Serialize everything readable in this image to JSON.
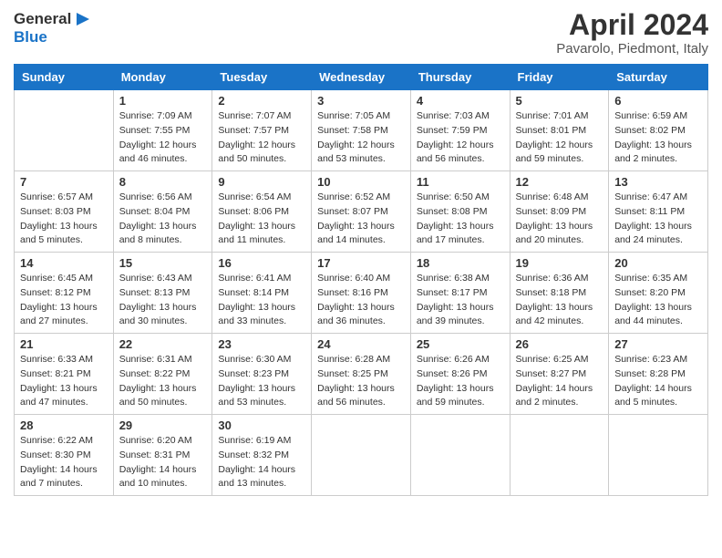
{
  "header": {
    "logo_line1": "General",
    "logo_line2": "Blue",
    "title": "April 2024",
    "subtitle": "Pavarolo, Piedmont, Italy"
  },
  "calendar": {
    "headers": [
      "Sunday",
      "Monday",
      "Tuesday",
      "Wednesday",
      "Thursday",
      "Friday",
      "Saturday"
    ],
    "weeks": [
      [
        {
          "day": null
        },
        {
          "day": 1,
          "sunrise": "Sunrise: 7:09 AM",
          "sunset": "Sunset: 7:55 PM",
          "daylight": "Daylight: 12 hours and 46 minutes."
        },
        {
          "day": 2,
          "sunrise": "Sunrise: 7:07 AM",
          "sunset": "Sunset: 7:57 PM",
          "daylight": "Daylight: 12 hours and 50 minutes."
        },
        {
          "day": 3,
          "sunrise": "Sunrise: 7:05 AM",
          "sunset": "Sunset: 7:58 PM",
          "daylight": "Daylight: 12 hours and 53 minutes."
        },
        {
          "day": 4,
          "sunrise": "Sunrise: 7:03 AM",
          "sunset": "Sunset: 7:59 PM",
          "daylight": "Daylight: 12 hours and 56 minutes."
        },
        {
          "day": 5,
          "sunrise": "Sunrise: 7:01 AM",
          "sunset": "Sunset: 8:01 PM",
          "daylight": "Daylight: 12 hours and 59 minutes."
        },
        {
          "day": 6,
          "sunrise": "Sunrise: 6:59 AM",
          "sunset": "Sunset: 8:02 PM",
          "daylight": "Daylight: 13 hours and 2 minutes."
        }
      ],
      [
        {
          "day": 7,
          "sunrise": "Sunrise: 6:57 AM",
          "sunset": "Sunset: 8:03 PM",
          "daylight": "Daylight: 13 hours and 5 minutes."
        },
        {
          "day": 8,
          "sunrise": "Sunrise: 6:56 AM",
          "sunset": "Sunset: 8:04 PM",
          "daylight": "Daylight: 13 hours and 8 minutes."
        },
        {
          "day": 9,
          "sunrise": "Sunrise: 6:54 AM",
          "sunset": "Sunset: 8:06 PM",
          "daylight": "Daylight: 13 hours and 11 minutes."
        },
        {
          "day": 10,
          "sunrise": "Sunrise: 6:52 AM",
          "sunset": "Sunset: 8:07 PM",
          "daylight": "Daylight: 13 hours and 14 minutes."
        },
        {
          "day": 11,
          "sunrise": "Sunrise: 6:50 AM",
          "sunset": "Sunset: 8:08 PM",
          "daylight": "Daylight: 13 hours and 17 minutes."
        },
        {
          "day": 12,
          "sunrise": "Sunrise: 6:48 AM",
          "sunset": "Sunset: 8:09 PM",
          "daylight": "Daylight: 13 hours and 20 minutes."
        },
        {
          "day": 13,
          "sunrise": "Sunrise: 6:47 AM",
          "sunset": "Sunset: 8:11 PM",
          "daylight": "Daylight: 13 hours and 24 minutes."
        }
      ],
      [
        {
          "day": 14,
          "sunrise": "Sunrise: 6:45 AM",
          "sunset": "Sunset: 8:12 PM",
          "daylight": "Daylight: 13 hours and 27 minutes."
        },
        {
          "day": 15,
          "sunrise": "Sunrise: 6:43 AM",
          "sunset": "Sunset: 8:13 PM",
          "daylight": "Daylight: 13 hours and 30 minutes."
        },
        {
          "day": 16,
          "sunrise": "Sunrise: 6:41 AM",
          "sunset": "Sunset: 8:14 PM",
          "daylight": "Daylight: 13 hours and 33 minutes."
        },
        {
          "day": 17,
          "sunrise": "Sunrise: 6:40 AM",
          "sunset": "Sunset: 8:16 PM",
          "daylight": "Daylight: 13 hours and 36 minutes."
        },
        {
          "day": 18,
          "sunrise": "Sunrise: 6:38 AM",
          "sunset": "Sunset: 8:17 PM",
          "daylight": "Daylight: 13 hours and 39 minutes."
        },
        {
          "day": 19,
          "sunrise": "Sunrise: 6:36 AM",
          "sunset": "Sunset: 8:18 PM",
          "daylight": "Daylight: 13 hours and 42 minutes."
        },
        {
          "day": 20,
          "sunrise": "Sunrise: 6:35 AM",
          "sunset": "Sunset: 8:20 PM",
          "daylight": "Daylight: 13 hours and 44 minutes."
        }
      ],
      [
        {
          "day": 21,
          "sunrise": "Sunrise: 6:33 AM",
          "sunset": "Sunset: 8:21 PM",
          "daylight": "Daylight: 13 hours and 47 minutes."
        },
        {
          "day": 22,
          "sunrise": "Sunrise: 6:31 AM",
          "sunset": "Sunset: 8:22 PM",
          "daylight": "Daylight: 13 hours and 50 minutes."
        },
        {
          "day": 23,
          "sunrise": "Sunrise: 6:30 AM",
          "sunset": "Sunset: 8:23 PM",
          "daylight": "Daylight: 13 hours and 53 minutes."
        },
        {
          "day": 24,
          "sunrise": "Sunrise: 6:28 AM",
          "sunset": "Sunset: 8:25 PM",
          "daylight": "Daylight: 13 hours and 56 minutes."
        },
        {
          "day": 25,
          "sunrise": "Sunrise: 6:26 AM",
          "sunset": "Sunset: 8:26 PM",
          "daylight": "Daylight: 13 hours and 59 minutes."
        },
        {
          "day": 26,
          "sunrise": "Sunrise: 6:25 AM",
          "sunset": "Sunset: 8:27 PM",
          "daylight": "Daylight: 14 hours and 2 minutes."
        },
        {
          "day": 27,
          "sunrise": "Sunrise: 6:23 AM",
          "sunset": "Sunset: 8:28 PM",
          "daylight": "Daylight: 14 hours and 5 minutes."
        }
      ],
      [
        {
          "day": 28,
          "sunrise": "Sunrise: 6:22 AM",
          "sunset": "Sunset: 8:30 PM",
          "daylight": "Daylight: 14 hours and 7 minutes."
        },
        {
          "day": 29,
          "sunrise": "Sunrise: 6:20 AM",
          "sunset": "Sunset: 8:31 PM",
          "daylight": "Daylight: 14 hours and 10 minutes."
        },
        {
          "day": 30,
          "sunrise": "Sunrise: 6:19 AM",
          "sunset": "Sunset: 8:32 PM",
          "daylight": "Daylight: 14 hours and 13 minutes."
        },
        {
          "day": null
        },
        {
          "day": null
        },
        {
          "day": null
        },
        {
          "day": null
        }
      ]
    ]
  }
}
